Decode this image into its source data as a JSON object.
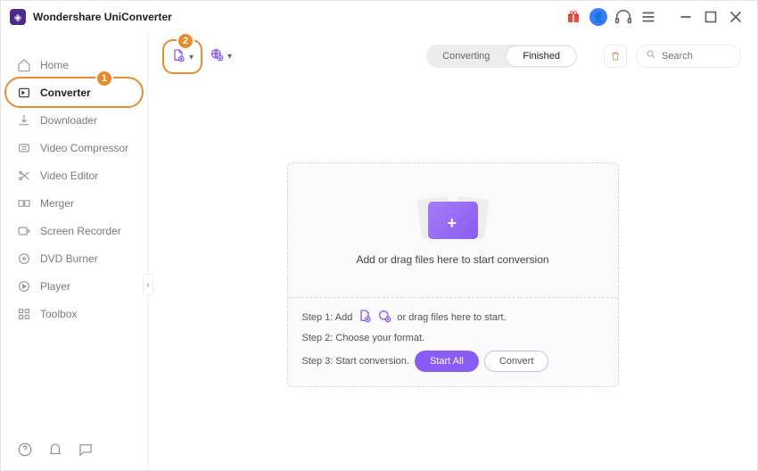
{
  "app": {
    "title": "Wondershare UniConverter"
  },
  "colors": {
    "accent": "#8b5cf4",
    "annotation": "#e88b2c"
  },
  "annotations": {
    "sidebar_badge": "1",
    "addfile_badge": "2"
  },
  "titlebar_icons": [
    "gift-icon",
    "avatar",
    "headset-icon",
    "hamburger-icon",
    "minimize-icon",
    "maximize-icon",
    "close-icon"
  ],
  "sidebar": {
    "items": [
      {
        "label": "Home",
        "icon": "home-icon"
      },
      {
        "label": "Converter",
        "icon": "converter-icon",
        "active": true
      },
      {
        "label": "Downloader",
        "icon": "downloader-icon"
      },
      {
        "label": "Video Compressor",
        "icon": "compressor-icon"
      },
      {
        "label": "Video Editor",
        "icon": "scissors-icon"
      },
      {
        "label": "Merger",
        "icon": "merger-icon"
      },
      {
        "label": "Screen Recorder",
        "icon": "recorder-icon"
      },
      {
        "label": "DVD Burner",
        "icon": "disc-icon"
      },
      {
        "label": "Player",
        "icon": "play-icon"
      },
      {
        "label": "Toolbox",
        "icon": "grid-icon"
      }
    ],
    "footer_icons": [
      "help-icon",
      "bell-icon",
      "feedback-icon"
    ]
  },
  "toolbar": {
    "add_file_icon": "add-file-icon",
    "add_url_icon": "add-url-icon",
    "segment": {
      "converting": "Converting",
      "finished": "Finished"
    },
    "trash_icon": "trash-icon",
    "search": {
      "placeholder": "Search",
      "value": ""
    }
  },
  "dropzone": {
    "text": "Add or drag files here to start conversion",
    "step1_prefix": "Step 1: Add",
    "step1_suffix": "or drag files here to start.",
    "step2": "Step 2: Choose your format.",
    "step3_prefix": "Step 3: Start conversion.",
    "start_all": "Start All",
    "convert": "Convert"
  }
}
